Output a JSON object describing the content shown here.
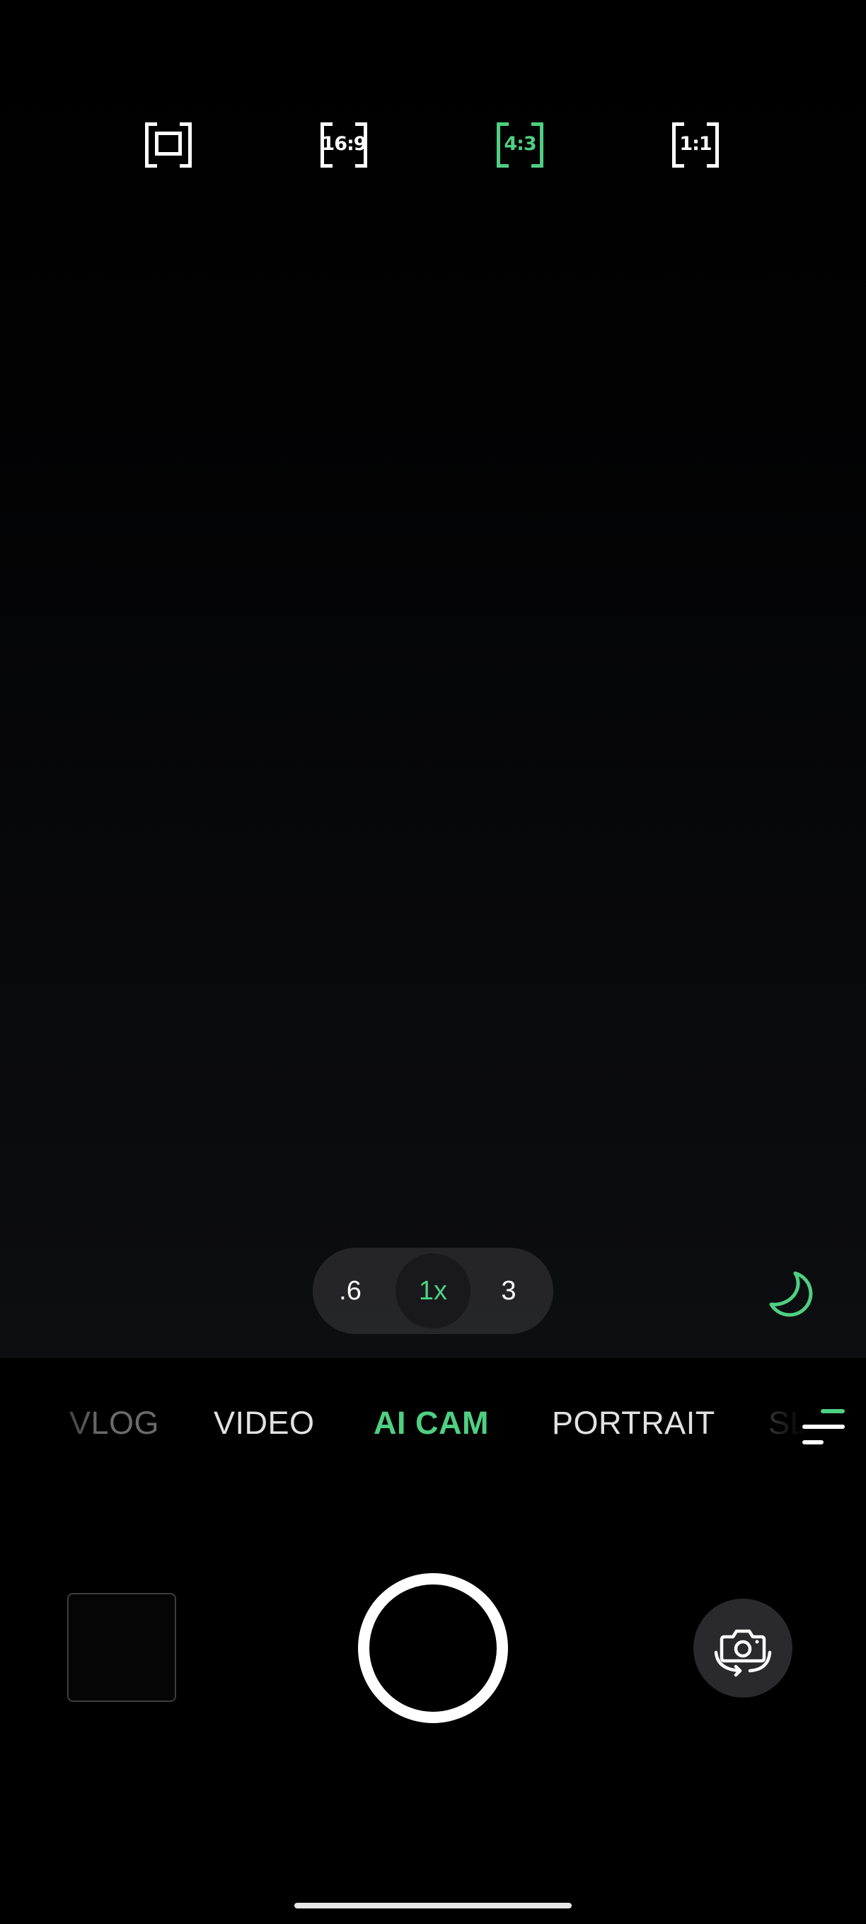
{
  "colors": {
    "accent": "#4fcf82",
    "text": "#ffffff",
    "inactive_mode": "#e2e2e2"
  },
  "aspect_ratios": [
    {
      "label": "",
      "icon": "full-frame-icon",
      "selected": false
    },
    {
      "label": "16:9",
      "icon": "aspect-16-9-icon",
      "selected": false
    },
    {
      "label": "4:3",
      "icon": "aspect-4-3-icon",
      "selected": true
    },
    {
      "label": "1:1",
      "icon": "aspect-1-1-icon",
      "selected": false
    }
  ],
  "zoom": {
    "options": [
      ".6",
      "1x",
      "3"
    ],
    "selected": "1x"
  },
  "night_mode": {
    "icon": "moon-icon"
  },
  "modes": [
    {
      "label": "VLOG"
    },
    {
      "label": "VIDEO"
    },
    {
      "label": "AI CAM"
    },
    {
      "label": "PORTRAIT"
    },
    {
      "label": "SL"
    }
  ],
  "active_mode": "AI CAM",
  "controls": {
    "gallery_icon": "gallery-thumbnail",
    "shutter_icon": "shutter-icon",
    "flip_icon": "flip-camera-icon",
    "more_modes_icon": "menu-lines-icon"
  }
}
